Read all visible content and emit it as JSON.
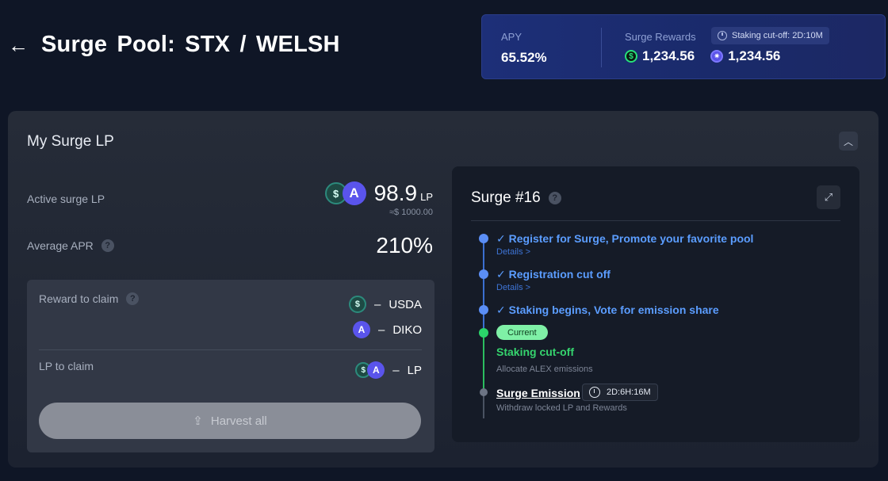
{
  "header": {
    "back_icon": "←",
    "title": "Surge Pool:  STX / WELSH"
  },
  "stats": {
    "apy_label": "APY",
    "apy_value": "65.52%",
    "rewards_label": "Surge Rewards",
    "cutoff_chip": "Staking cut-off: 2D:10M",
    "reward_1_value": "1,234.56",
    "reward_2_value": "1,234.56"
  },
  "panel": {
    "title": "My Surge LP",
    "active_lp_label": "Active surge LP",
    "active_lp_value": "98.9",
    "active_lp_unit": "LP",
    "active_lp_usd": "≈$ 1000.00",
    "apr_label": "Average APR",
    "apr_value": "210%",
    "reward_label": "Reward to claim",
    "reward_usda_amount": "–",
    "reward_usda_token": "USDA",
    "reward_diko_amount": "–",
    "reward_diko_token": "DIKO",
    "lp_claim_label": "LP to claim",
    "lp_claim_amount": "–",
    "lp_claim_unit": "LP",
    "harvest_label": "Harvest all"
  },
  "surge": {
    "title": "Surge #16",
    "steps": [
      {
        "title": "✓ Register for Surge, Promote your favorite pool",
        "sub": "Details >"
      },
      {
        "title": "✓ Registration cut off",
        "sub": "Details >"
      },
      {
        "title": "✓ Staking begins, Vote for emission share",
        "sub": ""
      },
      {
        "title": "Staking cut-off",
        "sub": "Allocate ALEX emissions",
        "badge": "Current"
      },
      {
        "title": "Surge Emission",
        "sub": "Withdraw locked LP and Rewards",
        "countdown": "2D:6H:16M"
      }
    ]
  },
  "colors": {
    "background": "#0f1626",
    "stats_card": "#1d2f78",
    "timeline_blue": "#5b9dff",
    "timeline_green": "#35d46e",
    "harvest_disabled": "#8a8e98"
  }
}
